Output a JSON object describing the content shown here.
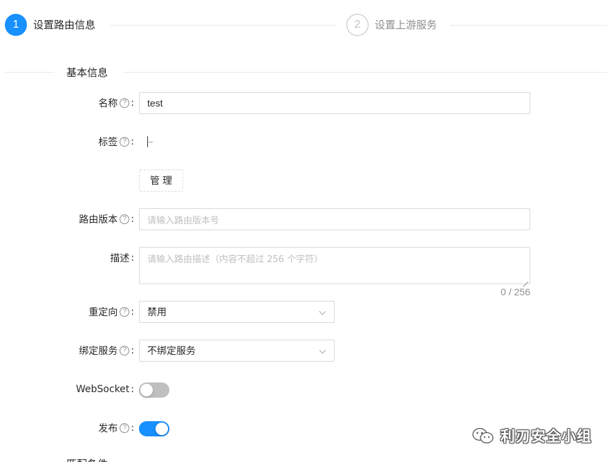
{
  "steps": [
    {
      "number": "1",
      "title": "设置路由信息",
      "state": "active"
    },
    {
      "number": "2",
      "title": "设置上游服务",
      "state": "wait"
    }
  ],
  "section": {
    "title": "基本信息"
  },
  "form": {
    "name": {
      "label": "名称",
      "value": "test"
    },
    "tags": {
      "label": "标签",
      "manage_button": "管理"
    },
    "version": {
      "label": "路由版本",
      "placeholder": "请输入路由版本号"
    },
    "description": {
      "label": "描述",
      "placeholder": "请输入路由描述（内容不超过 256 个字符）",
      "counter": "0 / 256"
    },
    "redirect": {
      "label": "重定向",
      "selected": "禁用"
    },
    "bind_service": {
      "label": "绑定服务",
      "selected": "不绑定服务"
    },
    "websocket": {
      "label": "WebSocket",
      "enabled": false
    },
    "publish": {
      "label": "发布",
      "enabled": true
    }
  },
  "next_section": {
    "title": "匹配条件"
  },
  "watermark": {
    "text": "利刃安全小组",
    "icon": "wechat-icon"
  },
  "colors": {
    "primary": "#1890ff",
    "border": "#d9d9d9",
    "placeholder": "#bfbfbf"
  }
}
